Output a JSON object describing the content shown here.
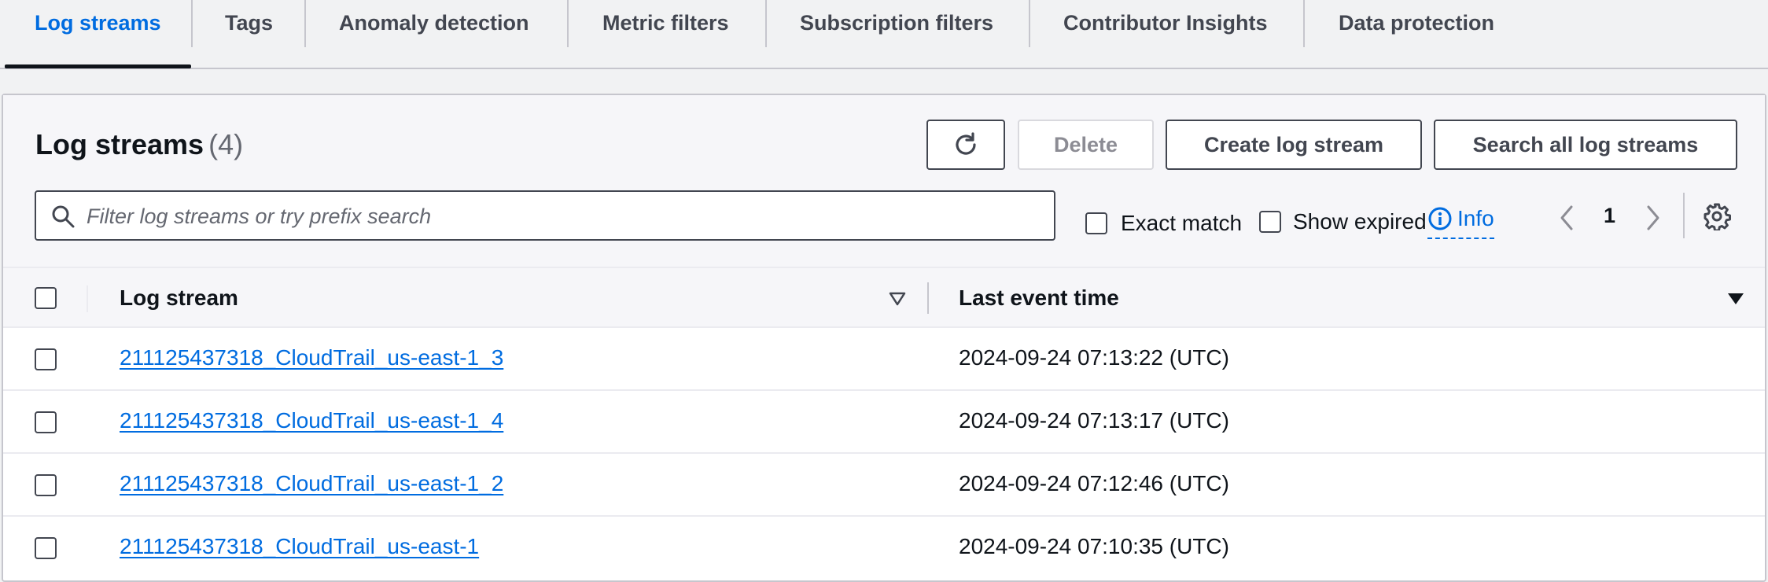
{
  "tabs": [
    {
      "label": "Log streams"
    },
    {
      "label": "Tags"
    },
    {
      "label": "Anomaly detection"
    },
    {
      "label": "Metric filters"
    },
    {
      "label": "Subscription filters"
    },
    {
      "label": "Contributor Insights"
    },
    {
      "label": "Data protection"
    }
  ],
  "panel": {
    "title": "Log streams",
    "count": "(4)"
  },
  "toolbar": {
    "delete_label": "Delete",
    "create_label": "Create log stream",
    "search_all_label": "Search all log streams"
  },
  "search": {
    "placeholder": "Filter log streams or try prefix search"
  },
  "filters": {
    "exact_match_label": "Exact match",
    "show_expired_label": "Show expired",
    "info_label": "Info"
  },
  "pagination": {
    "current_page": "1"
  },
  "table": {
    "columns": [
      "Log stream",
      "Last event time"
    ],
    "rows": [
      {
        "name": "211125437318_CloudTrail_us-east-1_3",
        "time": "2024-09-24 07:13:22 (UTC)"
      },
      {
        "name": "211125437318_CloudTrail_us-east-1_4",
        "time": "2024-09-24 07:13:17 (UTC)"
      },
      {
        "name": "211125437318_CloudTrail_us-east-1_2",
        "time": "2024-09-24 07:12:46 (UTC)"
      },
      {
        "name": "211125437318_CloudTrail_us-east-1",
        "time": "2024-09-24 07:10:35 (UTC)"
      }
    ]
  },
  "colors": {
    "accent": "#006ce0",
    "text": "#0f141a",
    "border": "#c6c6cd"
  },
  "icons": [
    "refresh-icon",
    "search-icon",
    "info-icon",
    "chevron-left-icon",
    "chevron-right-icon",
    "gear-icon",
    "sort-icon",
    "sort-desc-icon"
  ]
}
